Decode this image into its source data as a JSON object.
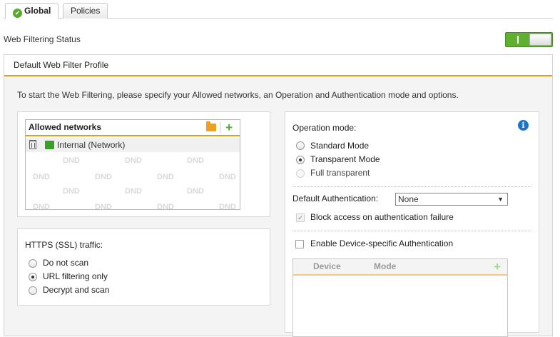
{
  "tabs": [
    {
      "label": "Global",
      "active": true,
      "icon": "check-circle-icon"
    },
    {
      "label": "Policies",
      "active": false
    }
  ],
  "status": {
    "label": "Web Filtering Status",
    "enabled": true,
    "toggle_on_text": "I"
  },
  "panel": {
    "title": "Default Web Filter Profile",
    "intro": "To start the Web Filtering, please specify your Allowed networks, an Operation and Authentication mode and options."
  },
  "allowed_networks": {
    "header": "Allowed networks",
    "add_glyph": "+",
    "items": [
      {
        "label": "Internal (Network)"
      }
    ],
    "placeholder": "DND"
  },
  "https": {
    "label": "HTTPS (SSL) traffic:",
    "options": [
      {
        "label": "Do not scan",
        "selected": false
      },
      {
        "label": "URL filtering only",
        "selected": true
      },
      {
        "label": "Decrypt and scan",
        "selected": false
      }
    ]
  },
  "operation_mode": {
    "label": "Operation mode:",
    "options": [
      {
        "label": "Standard Mode",
        "selected": false,
        "disabled": false
      },
      {
        "label": "Transparent Mode",
        "selected": true,
        "disabled": false
      },
      {
        "label": "Full transparent",
        "selected": false,
        "disabled": true
      }
    ]
  },
  "authentication": {
    "label": "Default Authentication:",
    "value": "None",
    "arrow": "▼",
    "block_access": {
      "label": "Block access on authentication failure",
      "checked": true,
      "disabled": true
    },
    "device_specific": {
      "label": "Enable Device-specific Authentication",
      "checked": false
    }
  },
  "device_grid": {
    "columns": [
      "Device",
      "Mode"
    ],
    "add_glyph": "+"
  },
  "info_glyph": "i",
  "colors": {
    "accent": "#e19a24",
    "toggle": "#5fb030",
    "add": "#4caf2a",
    "info": "#1e73c8"
  }
}
